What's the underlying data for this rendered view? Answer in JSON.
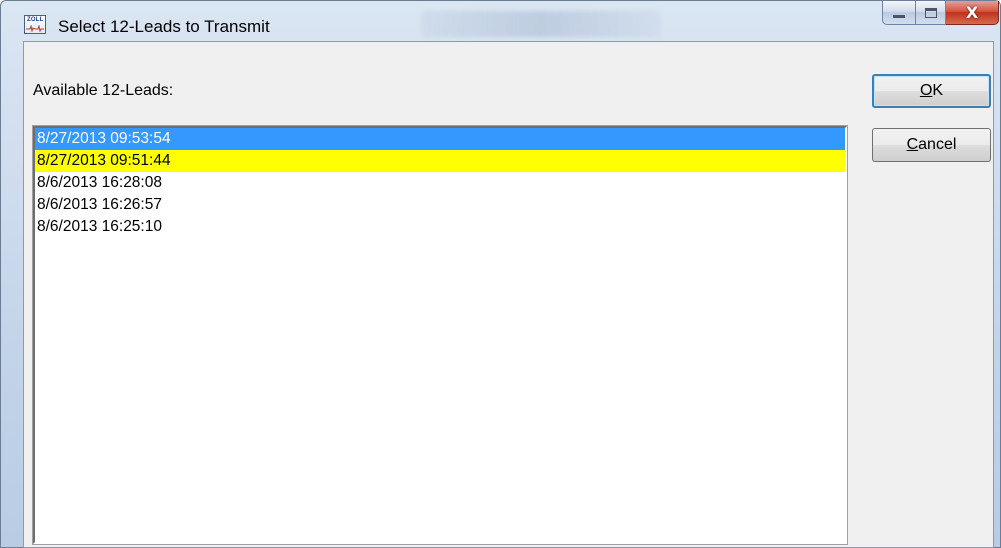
{
  "window": {
    "title": "Select 12-Leads to Transmit",
    "icon_name": "zoll-app-icon",
    "icon_brand_text": "ZOLL",
    "caption_buttons": {
      "minimize_icon": "minimize-icon",
      "maximize_icon": "maximize-icon",
      "close_glyph": "X"
    }
  },
  "list": {
    "label": "Available 12-Leads:",
    "items": [
      {
        "text": "8/27/2013 09:53:54",
        "state": "selected"
      },
      {
        "text": "8/27/2013 09:51:44",
        "state": "highlighted"
      },
      {
        "text": "8/6/2013 16:28:08",
        "state": "normal"
      },
      {
        "text": "8/6/2013 16:26:57",
        "state": "normal"
      },
      {
        "text": "8/6/2013 16:25:10",
        "state": "normal"
      }
    ]
  },
  "buttons": {
    "ok": {
      "mnemonic": "O",
      "rest": "K"
    },
    "cancel": {
      "mnemonic": "C",
      "rest": "ancel"
    }
  },
  "colors": {
    "selection": "#3399ff",
    "highlight": "#ffff00",
    "close_button": "#c0321d"
  }
}
